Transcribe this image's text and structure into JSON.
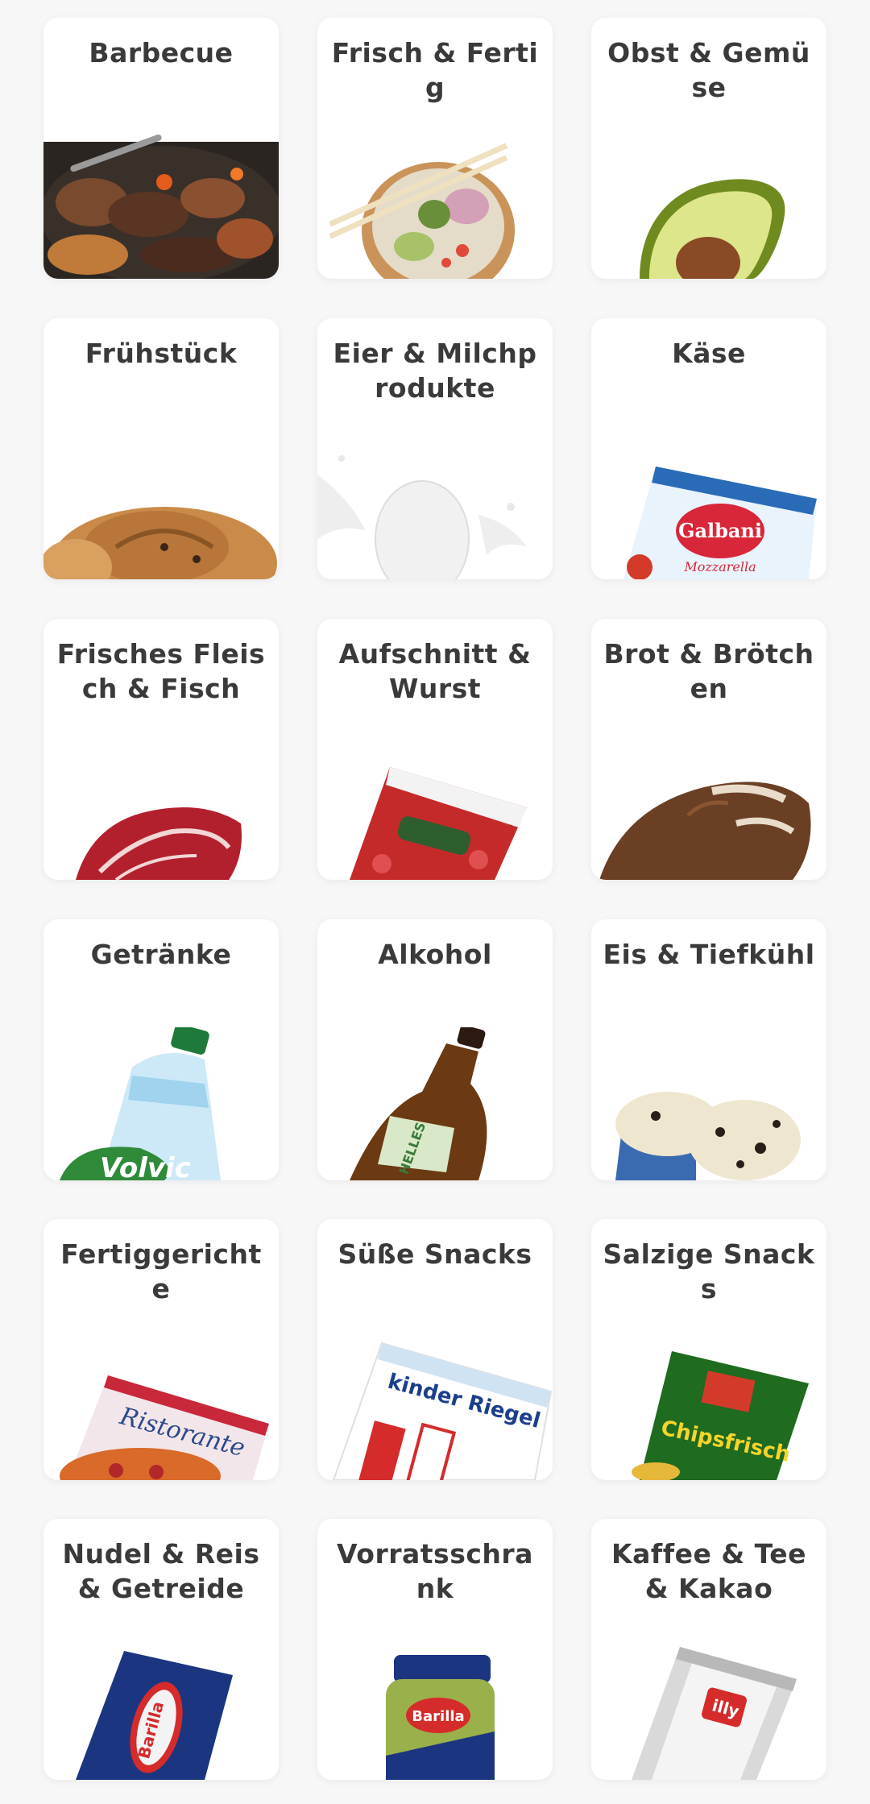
{
  "categories": [
    {
      "label": "Barbecue",
      "image": "barbecue-grill-image"
    },
    {
      "label": "Frisch & Fertig",
      "image": "poke-bowl-image"
    },
    {
      "label": "Obst & Gemüse",
      "image": "avocado-image"
    },
    {
      "label": "Frühstück",
      "image": "bread-roll-image"
    },
    {
      "label": "Eier & Milchprodukte",
      "image": "egg-milk-splash-image"
    },
    {
      "label": "Käse",
      "image": "galbani-mozzarella-image"
    },
    {
      "label": "Frisches Fleisch & Fisch",
      "image": "raw-steak-image"
    },
    {
      "label": "Aufschnitt & Wurst",
      "image": "salami-pack-image"
    },
    {
      "label": "Brot & Brötchen",
      "image": "bread-loaf-image"
    },
    {
      "label": "Getränke",
      "image": "water-bottle-image"
    },
    {
      "label": "Alkohol",
      "image": "beer-bottle-image"
    },
    {
      "label": "Eis & Tiefkühl",
      "image": "ice-cream-tub-image"
    },
    {
      "label": "Fertiggerichte",
      "image": "frozen-pizza-image"
    },
    {
      "label": "Süße Snacks",
      "image": "kinder-riegel-image"
    },
    {
      "label": "Salzige Snacks",
      "image": "chips-bag-image"
    },
    {
      "label": "Nudel & Reis & Getreide",
      "image": "pasta-box-image"
    },
    {
      "label": "Vorratsschrank",
      "image": "pesto-jar-image"
    },
    {
      "label": "Kaffee & Tee & Kakao",
      "image": "coffee-can-image"
    }
  ],
  "product_text": {
    "mozzarella_brand": "Galbani",
    "mozzarella_sub": "Mozzarella",
    "water_brand": "Volvic",
    "beer_label": "HELLES",
    "pizza_brand": "Ristorante",
    "kinder_brand": "kinder Riegel",
    "chips_brand": "Chipsfrisch",
    "pasta_brand": "Barilla",
    "pesto_brand": "Barilla",
    "coffee_brand": "illy"
  }
}
